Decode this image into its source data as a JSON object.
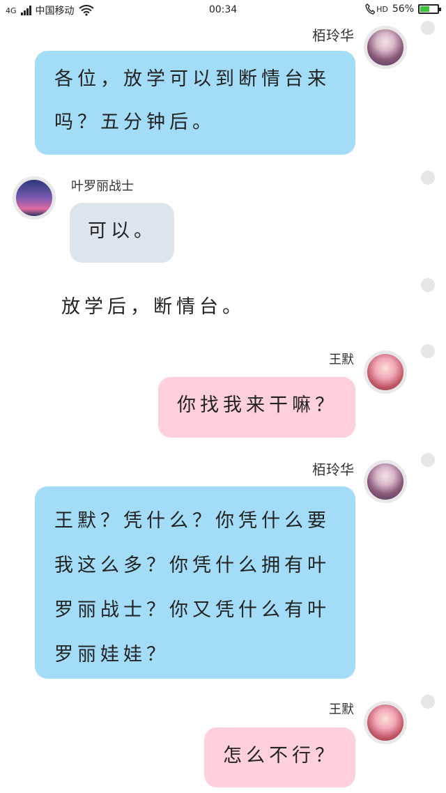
{
  "status_bar": {
    "network": "4G",
    "carrier": "中国移动",
    "time": "00:34",
    "hd": "HD",
    "battery": "56%",
    "battery_level": 0.56,
    "icons": [
      "signal-icon",
      "wifi-icon",
      "call-icon",
      "battery-icon"
    ]
  },
  "messages": [
    {
      "sender": "栢玲华",
      "side": "right",
      "color": "blue",
      "lines": [
        "各位，放学可以到断情台来",
        "吗？五分钟后。"
      ]
    },
    {
      "sender": "叶罗丽战士",
      "side": "left",
      "color": "gray",
      "lines": [
        "可以。"
      ]
    },
    {
      "sender": "",
      "side": "plain",
      "color": "",
      "lines": [
        "放学后，断情台。"
      ]
    },
    {
      "sender": "王默",
      "side": "right",
      "color": "pink",
      "lines": [
        "你找我来干嘛？"
      ]
    },
    {
      "sender": "栢玲华",
      "side": "right",
      "color": "blue",
      "lines": [
        "王默？凭什么？你凭什么要",
        "我这么多？你凭什么拥有叶",
        "罗丽战士？你又凭什么有叶",
        "罗丽娃娃？"
      ]
    },
    {
      "sender": "王默",
      "side": "right",
      "color": "pink",
      "lines": [
        "怎么不行？"
      ]
    }
  ],
  "colors": {
    "blue_bubble": "#a3dcf7",
    "pink_bubble": "#fdd0db",
    "gray_bubble": "#dde5ec",
    "dot": "#e6e6e6",
    "battery_fill": "#3cc43c"
  }
}
